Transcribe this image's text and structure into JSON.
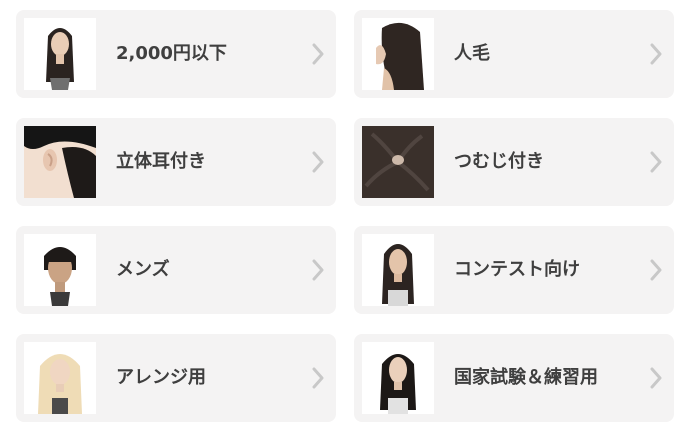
{
  "categories": [
    {
      "label": "2,000円以下",
      "thumb": "mannequin-long-dark"
    },
    {
      "label": "人毛",
      "thumb": "human-hair-side"
    },
    {
      "label": "立体耳付き",
      "thumb": "ear-closeup"
    },
    {
      "label": "つむじ付き",
      "thumb": "crown-whorl"
    },
    {
      "label": "メンズ",
      "thumb": "mannequin-short-dark"
    },
    {
      "label": "コンテスト向け",
      "thumb": "mannequin-long-dark"
    },
    {
      "label": "アレンジ用",
      "thumb": "mannequin-long-blonde"
    },
    {
      "label": "国家試験＆練習用",
      "thumb": "mannequin-long-dark"
    }
  ],
  "colors": {
    "card_bg": "#f4f3f3",
    "text": "#3f3f3f",
    "chevron": "#c8c8c8"
  }
}
